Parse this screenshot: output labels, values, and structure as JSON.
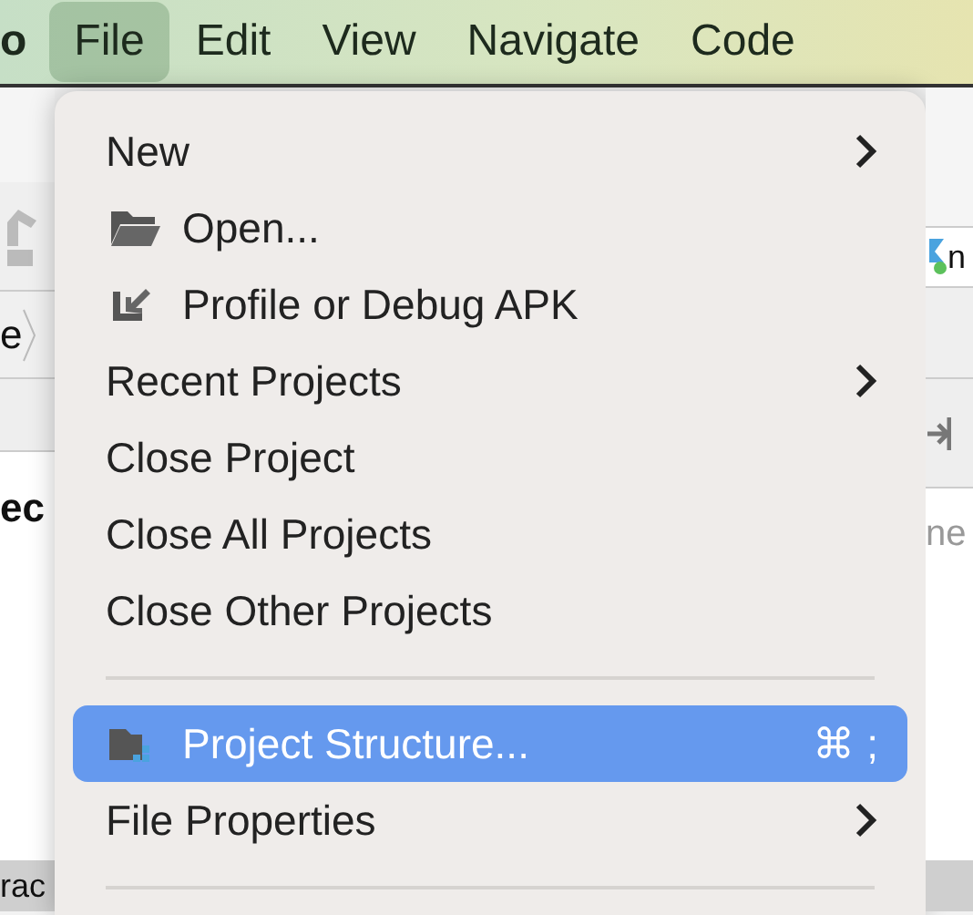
{
  "menubar": [
    {
      "label": "o",
      "selected": false
    },
    {
      "label": "File",
      "selected": true
    },
    {
      "label": "Edit",
      "selected": false
    },
    {
      "label": "View",
      "selected": false
    },
    {
      "label": "Navigate",
      "selected": false
    },
    {
      "label": "Code",
      "selected": false
    }
  ],
  "background": {
    "left_texts": [
      "e",
      "ec",
      "rac"
    ],
    "right_tab": "n",
    "right_text": "ne"
  },
  "menu": [
    {
      "kind": "plain",
      "label": "New",
      "submenu": true,
      "selected": false
    },
    {
      "kind": "folder",
      "label": "Open...",
      "submenu": false,
      "selected": false
    },
    {
      "kind": "import",
      "label": "Profile or Debug APK",
      "submenu": false,
      "selected": false
    },
    {
      "kind": "plain",
      "label": "Recent Projects",
      "submenu": true,
      "selected": false
    },
    {
      "kind": "plain",
      "label": "Close Project",
      "submenu": false,
      "selected": false
    },
    {
      "kind": "plain",
      "label": "Close All Projects",
      "submenu": false,
      "selected": false
    },
    {
      "kind": "plain",
      "label": "Close Other Projects",
      "submenu": false,
      "selected": false
    },
    {
      "kind": "separator"
    },
    {
      "kind": "project",
      "label": "Project Structure...",
      "submenu": false,
      "selected": true,
      "shortcut": "⌘ ;"
    },
    {
      "kind": "plain",
      "label": "File Properties",
      "submenu": true,
      "selected": false
    },
    {
      "kind": "separator"
    }
  ]
}
